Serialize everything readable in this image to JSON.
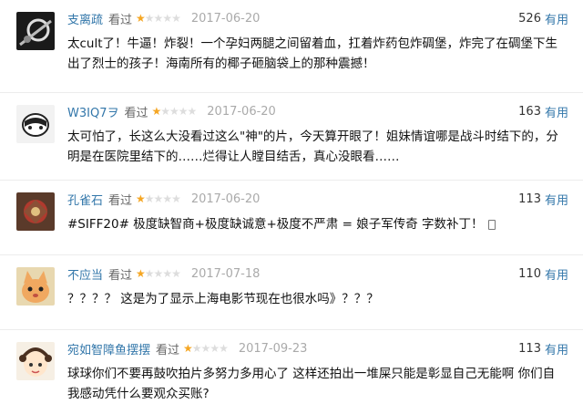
{
  "comments": [
    {
      "user": "支离疏",
      "status": "看过",
      "rating": 1,
      "date": "2017-06-20",
      "votes": "526",
      "useful_label": "有用",
      "text": "太cult了！牛逼！炸裂！一个孕妇两腿之间留着血，扛着炸药包炸碉堡，炸完了在碉堡下生出了烈士的孩子！海南所有的椰子砸脑袋上的那种震撼！"
    },
    {
      "user": "W3IQ7ヲ",
      "status": "看过",
      "rating": 1,
      "date": "2017-06-20",
      "votes": "163",
      "useful_label": "有用",
      "text": "太可怕了，长这么大没看过这么\"神\"的片，今天算开眼了！姐妹情谊哪是战斗时结下的，分明是在医院里结下的……烂得让人瞠目结舌，真心没眼看……"
    },
    {
      "user": "孔雀石",
      "status": "看过",
      "rating": 1,
      "date": "2017-06-20",
      "votes": "113",
      "useful_label": "有用",
      "text": "#SIFF20# 极度缺智商+极度缺诚意+极度不严肃 = 娘子军传奇 字数补丁！"
    },
    {
      "user": "不应当",
      "status": "看过",
      "rating": 1,
      "date": "2017-07-18",
      "votes": "110",
      "useful_label": "有用",
      "text": "？？？？ 这是为了显示上海电影节现在也很水吗》？？？"
    },
    {
      "user": "宛如智障鱼摆摆",
      "status": "看过",
      "rating": 1,
      "date": "2017-09-23",
      "votes": "113",
      "useful_label": "有用",
      "text": "球球你们不要再鼓吹拍片多努力多用心了 这样还拍出一堆屎只能是彰显自己无能啊 你们自我感动凭什么要观众买账?"
    }
  ]
}
